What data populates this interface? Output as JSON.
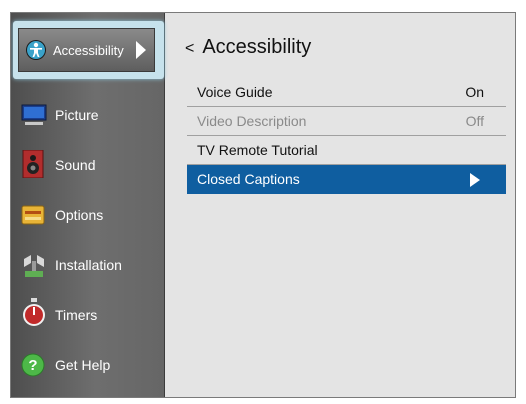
{
  "colors": {
    "sidebar_bg": "#5c5c5c",
    "selected_row": "#0f5ea0",
    "focus_frame": "#c6e2ec",
    "panel_bg": "#e4e4e4"
  },
  "sidebar": {
    "selected": {
      "label": "Accessibility",
      "icon": "accessibility-icon"
    },
    "items": [
      {
        "label": "Picture",
        "icon": "picture-icon"
      },
      {
        "label": "Sound",
        "icon": "speaker-icon"
      },
      {
        "label": "Options",
        "icon": "options-icon"
      },
      {
        "label": "Installation",
        "icon": "installation-icon"
      },
      {
        "label": "Timers",
        "icon": "timer-icon"
      },
      {
        "label": "Get Help",
        "icon": "help-icon"
      }
    ]
  },
  "main": {
    "back_symbol": "<",
    "title": "Accessibility",
    "rows": [
      {
        "label": "Voice Guide",
        "value": "On"
      },
      {
        "label": "Video Description",
        "value": "Off"
      },
      {
        "label": "TV Remote Tutorial",
        "value": ""
      },
      {
        "label": "Closed Captions",
        "value": ""
      }
    ]
  }
}
